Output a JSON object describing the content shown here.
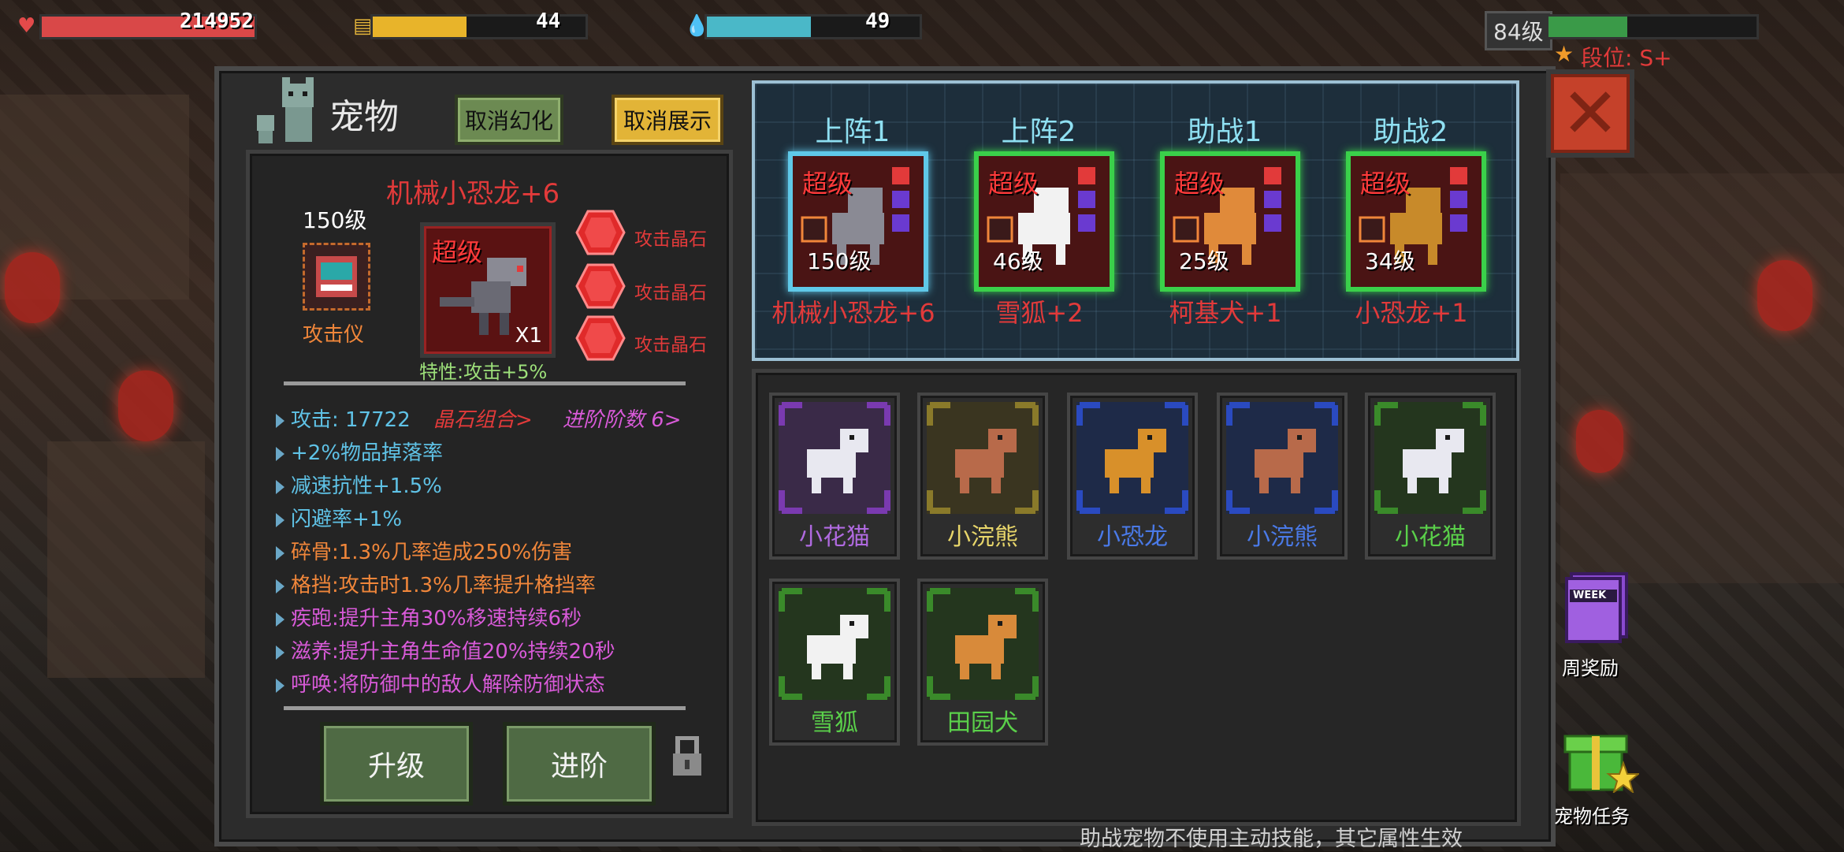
{
  "hud": {
    "hp": "214952",
    "energy": "44",
    "mana": "49",
    "level": "84级",
    "rank": "段位: S+",
    "hp_fill": 1.0,
    "energy_fill": 0.44,
    "mana_fill": 0.49,
    "xp_fill": 0.38
  },
  "panel": {
    "title": "宠物",
    "cancel_transform": "取消幻化",
    "cancel_display": "取消展示"
  },
  "pet": {
    "name": "机械小恐龙+6",
    "level": "150级",
    "equip_label": "攻击仪",
    "quality": "超级",
    "count": "X1",
    "trait": "特性:攻击+5%",
    "gems": [
      "攻击晶石",
      "攻击晶石",
      "攻击晶石"
    ]
  },
  "stats": [
    {
      "text": "攻击: 17722",
      "color": "#5fc2e6"
    },
    {
      "text": "+2%物品掉落率",
      "color": "#5fc2e6"
    },
    {
      "text": "减速抗性+1.5%",
      "color": "#5fc2e6"
    },
    {
      "text": "闪避率+1%",
      "color": "#5fc2e6"
    },
    {
      "text": "碎骨:1.3%几率造成250%伤害",
      "color": "#f0863a"
    },
    {
      "text": "格挡:攻击时1.3%几率提升格挡率",
      "color": "#f0863a"
    },
    {
      "text": "疾跑:提升主角30%移速持续6秒",
      "color": "#d85ad8"
    },
    {
      "text": "滋养:提升主角生命值20%持续20秒",
      "color": "#d85ad8"
    },
    {
      "text": "呼唤:将防御中的敌人解除防御状态",
      "color": "#d85ad8"
    }
  ],
  "stat_links": {
    "gem_combo": "晶石组合>",
    "advance_level": "进阶阶数 6>"
  },
  "actions": {
    "upgrade": "升级",
    "advance": "进阶"
  },
  "slots": [
    {
      "head": "上阵1",
      "quality": "超级",
      "level": "150级",
      "name": "机械小恐龙+6",
      "frame": "#5fc8e8"
    },
    {
      "head": "上阵2",
      "quality": "超级",
      "level": "46级",
      "name": "雪狐+2",
      "frame": "#3ad04a"
    },
    {
      "head": "助战1",
      "quality": "超级",
      "level": "25级",
      "name": "柯基犬+1",
      "frame": "#3ad04a"
    },
    {
      "head": "助战2",
      "quality": "超级",
      "level": "34级",
      "name": "小恐龙+1",
      "frame": "#3ad04a"
    }
  ],
  "inventory": [
    {
      "name": "小花猫",
      "color": "#b06ae0",
      "frame": "#7a3ab0",
      "bg": "#3a2a48"
    },
    {
      "name": "小浣熊",
      "color": "#e8d66a",
      "frame": "#8a7a2a",
      "bg": "#3a3520"
    },
    {
      "name": "小恐龙",
      "color": "#4a7ae8",
      "frame": "#2a4ac0",
      "bg": "#1e2a48"
    },
    {
      "name": "小浣熊",
      "color": "#4a7ae8",
      "frame": "#2a4ac0",
      "bg": "#1e2a48"
    },
    {
      "name": "小花猫",
      "color": "#5ad04a",
      "frame": "#3a8a2a",
      "bg": "#24361e"
    },
    {
      "name": "雪狐",
      "color": "#5ad04a",
      "frame": "#3a8a2a",
      "bg": "#24361e"
    },
    {
      "name": "田园犬",
      "color": "#5ad04a",
      "frame": "#3a8a2a",
      "bg": "#24361e"
    }
  ],
  "side": {
    "weekly_reward": "周奖励",
    "week_badge": "WEEK",
    "pet_task": "宠物任务"
  },
  "footer_note": "助战宠物不使用主动技能，其它属性生效"
}
